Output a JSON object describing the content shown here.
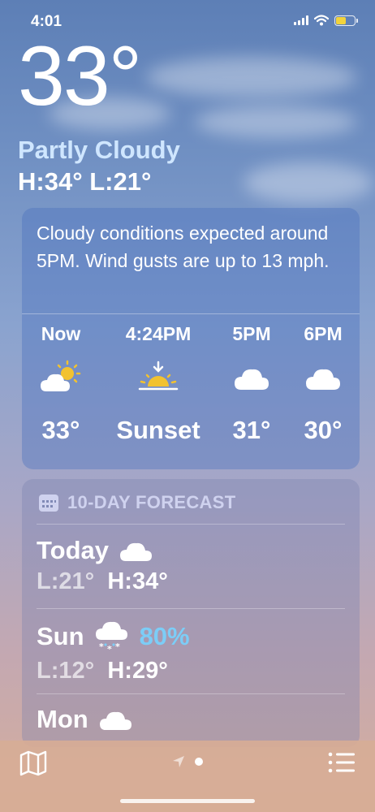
{
  "status_bar": {
    "time": "4:01"
  },
  "current": {
    "temperature": "33°",
    "condition": "Partly Cloudy",
    "high_low": "H:34°  L:21°"
  },
  "hourly": {
    "summary": "Cloudy conditions expected around 5PM. Wind gusts are up to 13 mph.",
    "items": [
      {
        "label": "Now",
        "icon": "partly-cloudy-icon",
        "temp": "33°"
      },
      {
        "label": "4:24PM",
        "icon": "sunset-icon",
        "temp": "Sunset"
      },
      {
        "label": "5PM",
        "icon": "cloud-icon",
        "temp": "31°"
      },
      {
        "label": "6PM",
        "icon": "cloud-icon",
        "temp": "30°"
      }
    ]
  },
  "forecast": {
    "header": "10-DAY FORECAST",
    "days": [
      {
        "day": "Today",
        "icon": "cloud-icon",
        "precip": "",
        "low": "L:21°",
        "high": "H:34°"
      },
      {
        "day": "Sun",
        "icon": "cloud-snow-icon",
        "precip": "80%",
        "low": "L:12°",
        "high": "H:29°"
      },
      {
        "day": "Mon",
        "icon": "cloud-icon",
        "precip": "",
        "low": "",
        "high": ""
      }
    ]
  },
  "toolbar": {
    "map_icon": "map-icon",
    "list_icon": "list-icon",
    "location_icon": "location-arrow-icon"
  },
  "colors": {
    "condition": "#cfe6ff",
    "precip": "#7ccdf7",
    "sun": "#f2c230"
  }
}
